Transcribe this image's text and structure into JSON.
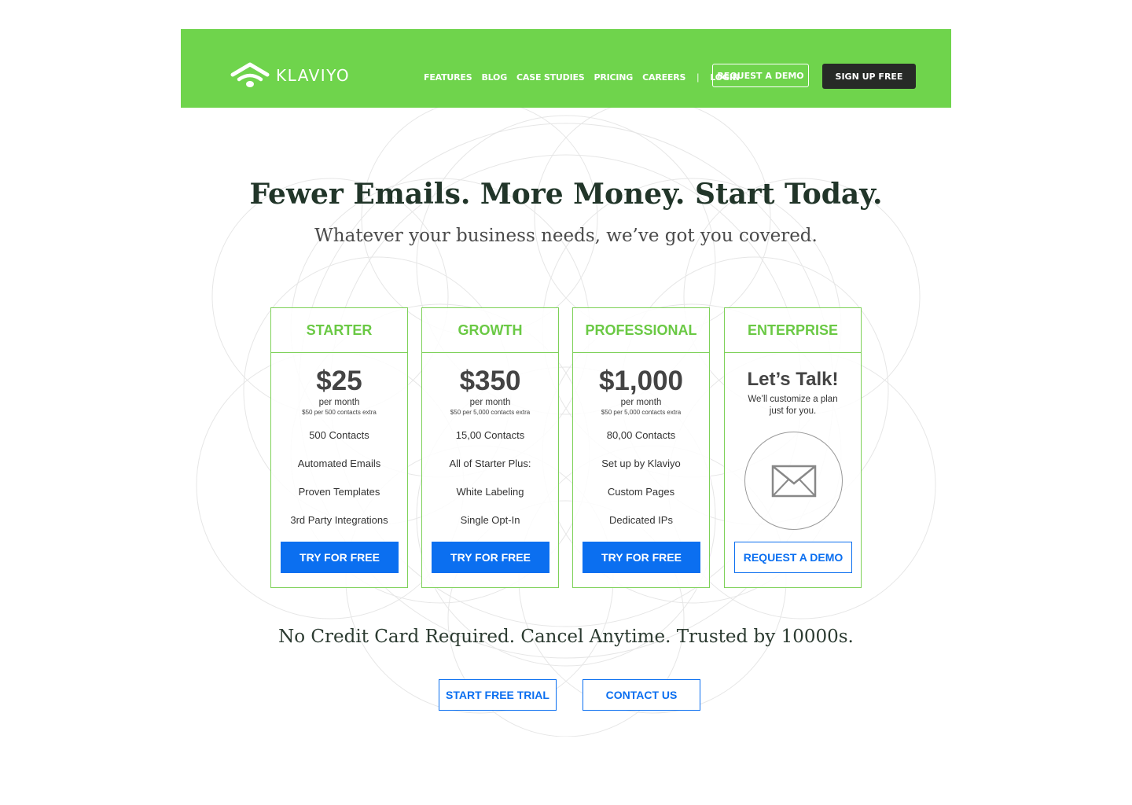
{
  "header": {
    "brand": "KLAVIYO",
    "nav": [
      "FEATURES",
      "BLOG",
      "CASE STUDIES",
      "PRICING",
      "CAREERS"
    ],
    "separator": "|",
    "login": "LOGIN",
    "request_demo": "REQUEST A DEMO",
    "sign_up": "SIGN UP FREE"
  },
  "hero": {
    "title": "Fewer Emails. More Money. Start Today.",
    "subtitle": "Whatever your business needs, we’ve got you covered."
  },
  "plans": [
    {
      "name": "STARTER",
      "price": "$25",
      "per": "per month",
      "extra": "$50 per 500 contacts extra",
      "features": [
        "500 Contacts",
        "Automated Emails",
        "Proven Templates",
        "3rd Party Integrations"
      ],
      "cta": "TRY FOR FREE"
    },
    {
      "name": "GROWTH",
      "price": "$350",
      "per": "per month",
      "extra": "$50 per 5,000 contacts extra",
      "features": [
        "15,00 Contacts",
        "All of Starter Plus:",
        "White Labeling",
        "Single Opt-In"
      ],
      "cta": "TRY FOR FREE"
    },
    {
      "name": "PROFESSIONAL",
      "price": "$1,000",
      "per": "per month",
      "extra": "$50 per 5,000 contacts extra",
      "features": [
        "80,00 Contacts",
        "Set up by Klaviyo",
        "Custom Pages",
        "Dedicated IPs"
      ],
      "cta": "TRY FOR FREE"
    },
    {
      "name": "ENTERPRISE",
      "headline": "Let’s Talk!",
      "description": "We’ll customize a plan just for you.",
      "icon": "envelope-icon",
      "cta": "REQUEST A DEMO"
    }
  ],
  "footer": {
    "tagline": "No Credit Card Required. Cancel Anytime. Trusted by 10000s.",
    "start_trial": "START FREE TRIAL",
    "contact": "CONTACT US"
  },
  "colors": {
    "brand_green": "#6fd44c",
    "accent_blue": "#0b6ff0",
    "dark_button": "#272a27"
  }
}
